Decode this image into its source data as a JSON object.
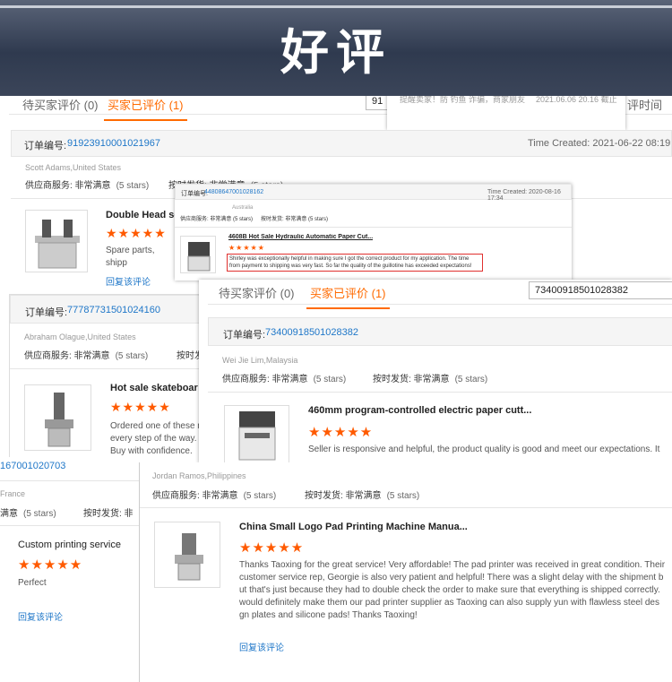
{
  "banner": {
    "title": "好评"
  },
  "p1": {
    "tab_pending": "待买家评价 (0)",
    "tab_done": "买家已评价 (1)",
    "search_value": "91",
    "sort_label": "评时间",
    "popup_text": "提醒卖家！防 钓鱼 诈骗，商家朋友",
    "popup_date": "2021.06.06 20.16 截止",
    "order_label": "订单编号:",
    "order_no": "91923910001021967",
    "time_created": "Time Created: 2021-06-22 08:19",
    "buyer": "Scott Adams,United States",
    "svc1_label": "供应商服务: 非常满意",
    "svc1_stars": "(5 stars)",
    "svc2_label": "按时发货: 非常满意",
    "svc2_stars": "(5 stars)",
    "product_title": "Double Head se",
    "stars": "★★★★★",
    "body": "Spare parts, shipp",
    "reply": "回复该评论"
  },
  "p2": {
    "order_label": "订单编号:",
    "order_no": "44808647001028162",
    "time_created": "Time Created: 2020-08-16 17:34",
    "buyer": "Australia",
    "svc1": "供应商服务: 非常满意 (5 stars)",
    "svc2": "按时发货: 非常满意 (5 stars)",
    "product_title": "4608B Hot Sale Hydraulic Automatic Paper Cut...",
    "stars": "★★★★★",
    "body": "Shirley was exceptionally helpful in making sure I got the correct product for my application. The time from payment to shipping was very fast. So far the quality of the guillotine has exceeded expectations!"
  },
  "p3": {
    "order_label": "订单编号:",
    "order_no": "77787731501024160",
    "buyer": "Abraham Olague,United States",
    "svc1_label": "供应商服务: 非常满意",
    "svc1_stars": "(5 stars)",
    "svc2_label": "按时发",
    "product_title": "Hot sale skateboar",
    "stars": "★★★★★",
    "body_lines": [
      "Ordered one of these m",
      "every step of the way.",
      "Buy with confidence."
    ]
  },
  "p4": {
    "tab_pending": "待买家评价 (0)",
    "tab_done": "买家已评价 (1)",
    "search_value": "73400918501028382",
    "order_label": "订单编号:",
    "order_no": "73400918501028382",
    "buyer": "Wei Jie Lim,Malaysia",
    "svc1_label": "供应商服务: 非常满意",
    "svc1_stars": "(5 stars)",
    "svc2_label": "按时发货: 非常满意",
    "svc2_stars": "(5 stars)",
    "product_title": "460mm program-controlled electric paper cutt...",
    "stars": "★★★★★",
    "body": "Seller is responsive and helpful, the product quality is good and meet our expectations. It"
  },
  "p5": {
    "order_no": "167001020703",
    "country": "France",
    "svc1_label": "满意",
    "svc1_stars": "(5 stars)",
    "svc2_label": "按时发货: 非",
    "product_title": "Custom printing service",
    "stars": "★★★★★",
    "body": "Perfect",
    "reply": "回复该评论"
  },
  "p6": {
    "buyer": "Jordan Ramos,Philippines",
    "svc1_label": "供应商服务: 非常满意",
    "svc1_stars": "(5 stars)",
    "svc2_label": "按时发货: 非常满意",
    "svc2_stars": "(5 stars)",
    "product_title": "China Small Logo Pad Printing Machine Manua...",
    "stars": "★★★★★",
    "body_lines": [
      "Thanks Taoxing for the great service! Very affordable! The pad printer was received in great condition. Their",
      "customer service rep, Georgie is also very patient and helpful! There was a slight delay with the shipment b",
      "ut that's just because they had to double check the order to make sure that everything is shipped correctly.",
      "would definitely make them our pad printer supplier as Taoxing can also supply yun with flawless steel des",
      "gn plates and silicone pads! Thanks Taoxing!"
    ],
    "reply": "回复该评论"
  }
}
